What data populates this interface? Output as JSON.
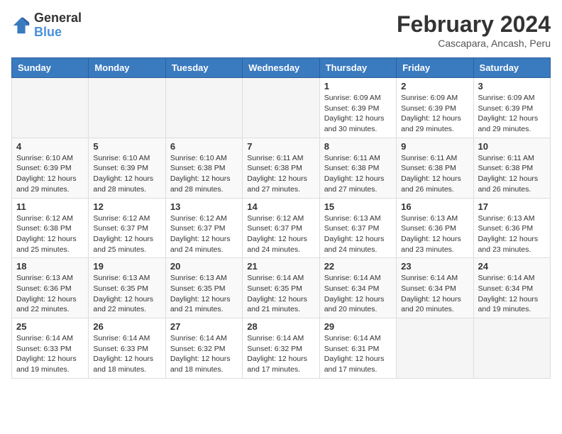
{
  "logo": {
    "general": "General",
    "blue": "Blue"
  },
  "header": {
    "month_year": "February 2024",
    "location": "Cascapara, Ancash, Peru"
  },
  "days_of_week": [
    "Sunday",
    "Monday",
    "Tuesday",
    "Wednesday",
    "Thursday",
    "Friday",
    "Saturday"
  ],
  "weeks": [
    [
      {
        "day": "",
        "info": ""
      },
      {
        "day": "",
        "info": ""
      },
      {
        "day": "",
        "info": ""
      },
      {
        "day": "",
        "info": ""
      },
      {
        "day": "1",
        "info": "Sunrise: 6:09 AM\nSunset: 6:39 PM\nDaylight: 12 hours and 30 minutes."
      },
      {
        "day": "2",
        "info": "Sunrise: 6:09 AM\nSunset: 6:39 PM\nDaylight: 12 hours and 29 minutes."
      },
      {
        "day": "3",
        "info": "Sunrise: 6:09 AM\nSunset: 6:39 PM\nDaylight: 12 hours and 29 minutes."
      }
    ],
    [
      {
        "day": "4",
        "info": "Sunrise: 6:10 AM\nSunset: 6:39 PM\nDaylight: 12 hours and 29 minutes."
      },
      {
        "day": "5",
        "info": "Sunrise: 6:10 AM\nSunset: 6:39 PM\nDaylight: 12 hours and 28 minutes."
      },
      {
        "day": "6",
        "info": "Sunrise: 6:10 AM\nSunset: 6:38 PM\nDaylight: 12 hours and 28 minutes."
      },
      {
        "day": "7",
        "info": "Sunrise: 6:11 AM\nSunset: 6:38 PM\nDaylight: 12 hours and 27 minutes."
      },
      {
        "day": "8",
        "info": "Sunrise: 6:11 AM\nSunset: 6:38 PM\nDaylight: 12 hours and 27 minutes."
      },
      {
        "day": "9",
        "info": "Sunrise: 6:11 AM\nSunset: 6:38 PM\nDaylight: 12 hours and 26 minutes."
      },
      {
        "day": "10",
        "info": "Sunrise: 6:11 AM\nSunset: 6:38 PM\nDaylight: 12 hours and 26 minutes."
      }
    ],
    [
      {
        "day": "11",
        "info": "Sunrise: 6:12 AM\nSunset: 6:38 PM\nDaylight: 12 hours and 25 minutes."
      },
      {
        "day": "12",
        "info": "Sunrise: 6:12 AM\nSunset: 6:37 PM\nDaylight: 12 hours and 25 minutes."
      },
      {
        "day": "13",
        "info": "Sunrise: 6:12 AM\nSunset: 6:37 PM\nDaylight: 12 hours and 24 minutes."
      },
      {
        "day": "14",
        "info": "Sunrise: 6:12 AM\nSunset: 6:37 PM\nDaylight: 12 hours and 24 minutes."
      },
      {
        "day": "15",
        "info": "Sunrise: 6:13 AM\nSunset: 6:37 PM\nDaylight: 12 hours and 24 minutes."
      },
      {
        "day": "16",
        "info": "Sunrise: 6:13 AM\nSunset: 6:36 PM\nDaylight: 12 hours and 23 minutes."
      },
      {
        "day": "17",
        "info": "Sunrise: 6:13 AM\nSunset: 6:36 PM\nDaylight: 12 hours and 23 minutes."
      }
    ],
    [
      {
        "day": "18",
        "info": "Sunrise: 6:13 AM\nSunset: 6:36 PM\nDaylight: 12 hours and 22 minutes."
      },
      {
        "day": "19",
        "info": "Sunrise: 6:13 AM\nSunset: 6:35 PM\nDaylight: 12 hours and 22 minutes."
      },
      {
        "day": "20",
        "info": "Sunrise: 6:13 AM\nSunset: 6:35 PM\nDaylight: 12 hours and 21 minutes."
      },
      {
        "day": "21",
        "info": "Sunrise: 6:14 AM\nSunset: 6:35 PM\nDaylight: 12 hours and 21 minutes."
      },
      {
        "day": "22",
        "info": "Sunrise: 6:14 AM\nSunset: 6:34 PM\nDaylight: 12 hours and 20 minutes."
      },
      {
        "day": "23",
        "info": "Sunrise: 6:14 AM\nSunset: 6:34 PM\nDaylight: 12 hours and 20 minutes."
      },
      {
        "day": "24",
        "info": "Sunrise: 6:14 AM\nSunset: 6:34 PM\nDaylight: 12 hours and 19 minutes."
      }
    ],
    [
      {
        "day": "25",
        "info": "Sunrise: 6:14 AM\nSunset: 6:33 PM\nDaylight: 12 hours and 19 minutes."
      },
      {
        "day": "26",
        "info": "Sunrise: 6:14 AM\nSunset: 6:33 PM\nDaylight: 12 hours and 18 minutes."
      },
      {
        "day": "27",
        "info": "Sunrise: 6:14 AM\nSunset: 6:32 PM\nDaylight: 12 hours and 18 minutes."
      },
      {
        "day": "28",
        "info": "Sunrise: 6:14 AM\nSunset: 6:32 PM\nDaylight: 12 hours and 17 minutes."
      },
      {
        "day": "29",
        "info": "Sunrise: 6:14 AM\nSunset: 6:31 PM\nDaylight: 12 hours and 17 minutes."
      },
      {
        "day": "",
        "info": ""
      },
      {
        "day": "",
        "info": ""
      }
    ]
  ]
}
